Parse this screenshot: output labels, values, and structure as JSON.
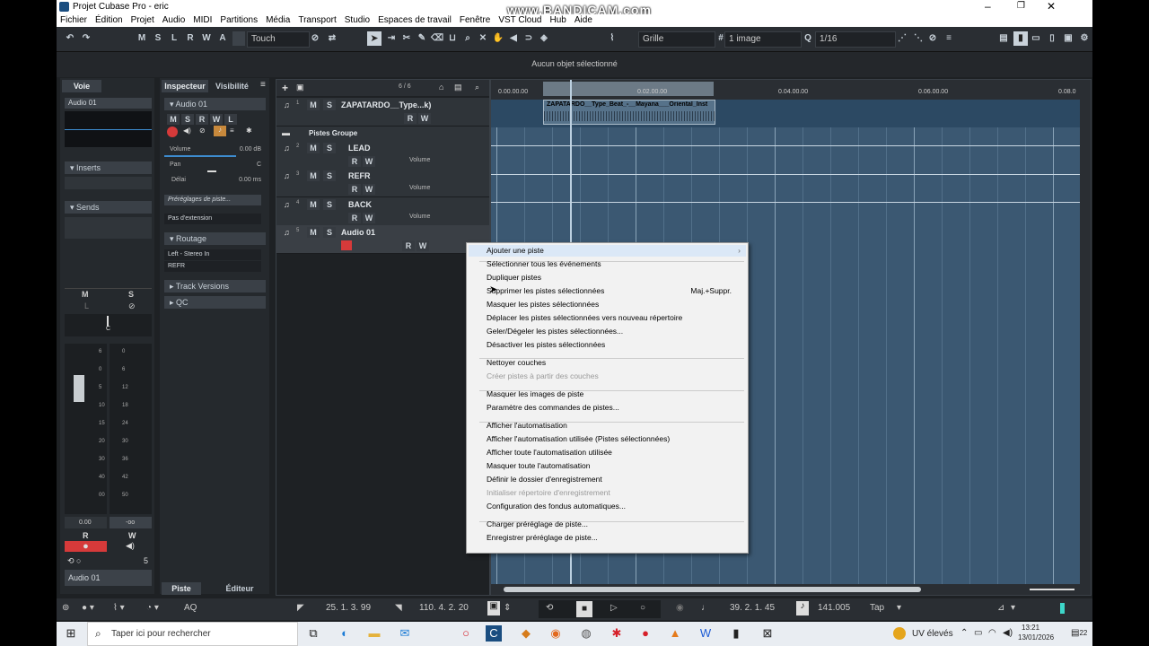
{
  "window": {
    "title": "Projet Cubase Pro - eric",
    "watermark": "www.BANDICAM.com"
  },
  "menu": [
    "Fichier",
    "Édition",
    "Projet",
    "Audio",
    "MIDI",
    "Partitions",
    "Média",
    "Transport",
    "Studio",
    "Espaces de travail",
    "Fenêtre",
    "VST Cloud",
    "Hub",
    "Aide"
  ],
  "toolbar": {
    "mode_buttons": [
      "M",
      "S",
      "L",
      "R",
      "W",
      "A"
    ],
    "automation_mode": "Touch",
    "snap_type": "Grille",
    "grid_value": "1 image",
    "quantize": "1/16"
  },
  "info_line": "Aucun objet sélectionné",
  "left_zone": {
    "tab_voie": "Voie",
    "channel_name": "Audio 01",
    "inserts": "Inserts",
    "sends": "Sends",
    "m": "M",
    "s": "S",
    "l": "L",
    "pan_value": "C",
    "fader_scale": [
      "6",
      "0",
      "5",
      "10",
      "15",
      "20",
      "30",
      "40",
      "00"
    ],
    "meter_scale": [
      "0",
      "6",
      "12",
      "18",
      "24",
      "30",
      "36",
      "42",
      "50"
    ],
    "volume_readout": "0.00",
    "peak_readout": "-oo",
    "r": "R",
    "w": "W",
    "send_count": "5",
    "channel_footer": "Audio 01"
  },
  "inspector": {
    "tab_inspector": "Inspecteur",
    "tab_visibility": "Visibilité",
    "track_name": "Audio 01",
    "buttons": [
      "M",
      "S",
      "R",
      "W",
      "L"
    ],
    "volume_label": "Volume",
    "volume_value": "0.00 dB",
    "pan_label": "Pan",
    "pan_value": "C",
    "delay_label": "Délai",
    "delay_value": "0.00 ms",
    "presets": "Préréglages de piste...",
    "extension": "Pas d'extension",
    "routing": "Routage",
    "input": "Left - Stereo In",
    "output": "REFR",
    "track_versions": "Track Versions",
    "qc": "QC",
    "tab_piste": "Piste",
    "tab_editeur": "Éditeur"
  },
  "tracklist": {
    "count": "6 / 6",
    "tracks": [
      {
        "num": "1",
        "name": "ZAPATARDO__Type...k)"
      },
      {
        "num": "",
        "name": "Pistes Groupe"
      },
      {
        "num": "2",
        "name": "LEAD",
        "automation": "Volume"
      },
      {
        "num": "3",
        "name": "REFR",
        "automation": "Volume"
      },
      {
        "num": "4",
        "name": "BACK",
        "automation": "Volume"
      },
      {
        "num": "5",
        "name": "Audio 01"
      }
    ],
    "rw": [
      "R",
      "W"
    ]
  },
  "ruler": [
    "0.00.00.00",
    "0.02.00.00",
    "0.04.00.00",
    "0.06.00.00",
    "0.08.0"
  ],
  "event_name": "ZAPATARDO__Type_Beat_-__Mayana___Oriental_Inst",
  "context_menu": {
    "items": [
      {
        "label": "Ajouter une piste",
        "highlight": true,
        "submenu": true
      },
      {
        "label": "Sélectionner tous les événements"
      },
      {
        "label": "Dupliquer pistes"
      },
      {
        "label": "Supprimer les pistes sélectionnées",
        "shortcut": "Maj.+Suppr."
      },
      {
        "label": "Masquer les pistes sélectionnées"
      },
      {
        "label": "Déplacer les pistes sélectionnées vers nouveau répertoire"
      },
      {
        "label": "Geler/Dégeler les pistes sélectionnées..."
      },
      {
        "label": "Désactiver les pistes sélectionnées"
      },
      {
        "label": "Nettoyer couches"
      },
      {
        "label": "Créer pistes à partir des couches",
        "disabled": true
      },
      {
        "label": "Masquer les images de piste"
      },
      {
        "label": "Paramètre des commandes de pistes..."
      },
      {
        "label": "Afficher l'automatisation"
      },
      {
        "label": "Afficher l'automatisation utilisée (Pistes sélectionnées)"
      },
      {
        "label": "Afficher toute l'automatisation utilisée"
      },
      {
        "label": "Masquer toute l'automatisation"
      },
      {
        "label": "Définir le dossier d'enregistrement"
      },
      {
        "label": "Initialiser répertoire d'enregistrement",
        "disabled": true
      },
      {
        "label": "Configuration des fondus automatiques..."
      },
      {
        "label": "Charger préréglage de piste..."
      },
      {
        "label": "Enregistrer préréglage de piste..."
      }
    ]
  },
  "transport": {
    "left_locator": "25. 1. 3. 99",
    "right_locator": "110. 4. 2. 20",
    "position": "39. 2. 1. 45",
    "tempo": "141.005",
    "tap": "Tap",
    "aq": "AQ"
  },
  "taskbar": {
    "search_placeholder": "Taper ici pour rechercher",
    "uv": "UV élevés",
    "time": "13:21",
    "date": "13/01/2026",
    "badge": "22"
  },
  "colors": {
    "accent": "#3d8ccf",
    "record": "#d63a3a",
    "grid": "#3b5872",
    "menu_highlight": "#dbe8f7"
  }
}
